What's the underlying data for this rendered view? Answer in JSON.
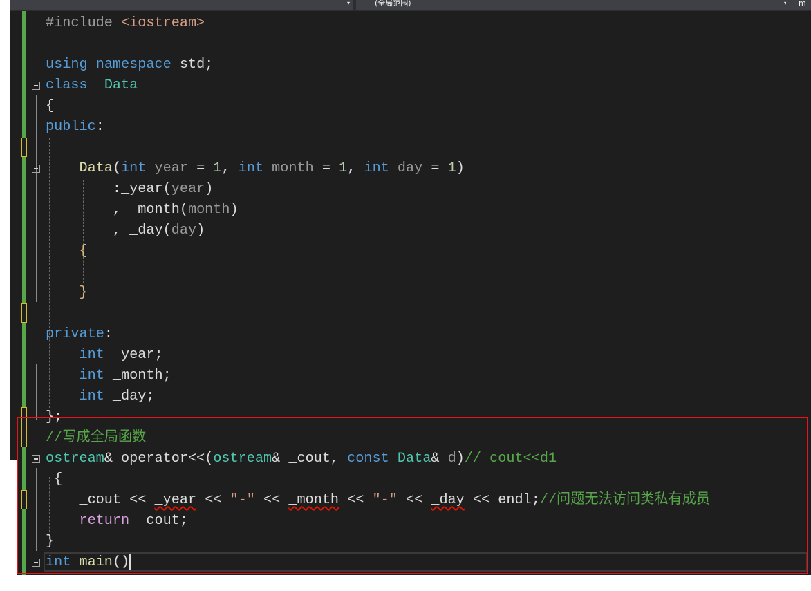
{
  "toolbar": {
    "scope_dropdown": "(全局范围)",
    "member_dropdown": "m"
  },
  "colors": {
    "keyword": "#569cd6",
    "type": "#4ec9b0",
    "function": "#dcdcaa",
    "comment": "#57a64a",
    "string": "#d69d85",
    "highlight_box": "#e8141a"
  },
  "code_lines": [
    [
      [
        "#include ",
        "pp"
      ],
      [
        "<iostream>",
        "st"
      ]
    ],
    [],
    [
      [
        "using",
        "kw"
      ],
      [
        " ",
        ""
      ],
      [
        "namespace",
        "kw"
      ],
      [
        " std;",
        ""
      ]
    ],
    [
      [
        "class",
        "kw"
      ],
      [
        "  ",
        ""
      ],
      [
        "Data",
        "ty"
      ]
    ],
    [
      [
        "{",
        ""
      ]
    ],
    [
      [
        "public",
        "kw"
      ],
      [
        ":",
        ""
      ]
    ],
    [],
    [
      [
        "    ",
        ""
      ],
      [
        "Data",
        "fn"
      ],
      [
        "(",
        ""
      ],
      [
        "int",
        "kw"
      ],
      [
        " ",
        ""
      ],
      [
        "year",
        "pa"
      ],
      [
        " = ",
        ""
      ],
      [
        "1",
        "nu"
      ],
      [
        ", ",
        ""
      ],
      [
        "int",
        "kw"
      ],
      [
        " ",
        ""
      ],
      [
        "month",
        "pa"
      ],
      [
        " = ",
        ""
      ],
      [
        "1",
        "nu"
      ],
      [
        ", ",
        ""
      ],
      [
        "int",
        "kw"
      ],
      [
        " ",
        ""
      ],
      [
        "day",
        "pa"
      ],
      [
        " = ",
        ""
      ],
      [
        "1",
        "nu"
      ],
      [
        ")",
        ""
      ]
    ],
    [
      [
        "        :_year(",
        ""
      ],
      [
        "year",
        "pa"
      ],
      [
        ")",
        ""
      ]
    ],
    [
      [
        "        , _month(",
        ""
      ],
      [
        "month",
        "pa"
      ],
      [
        ")",
        ""
      ]
    ],
    [
      [
        "        , _day(",
        ""
      ],
      [
        "day",
        "pa"
      ],
      [
        ")",
        ""
      ]
    ],
    [
      [
        "    ",
        ""
      ],
      [
        "{",
        "br"
      ]
    ],
    [],
    [
      [
        "    ",
        ""
      ],
      [
        "}",
        "br"
      ]
    ],
    [],
    [
      [
        "private",
        "kw"
      ],
      [
        ":",
        ""
      ]
    ],
    [
      [
        "    ",
        ""
      ],
      [
        "int",
        "kw"
      ],
      [
        " _year;",
        ""
      ]
    ],
    [
      [
        "    ",
        ""
      ],
      [
        "int",
        "kw"
      ],
      [
        " _month;",
        ""
      ]
    ],
    [
      [
        "    ",
        ""
      ],
      [
        "int",
        "kw"
      ],
      [
        " _day;",
        ""
      ]
    ],
    [
      [
        "};",
        ""
      ]
    ],
    [
      [
        "//写成全局函数",
        "cm"
      ]
    ],
    [
      [
        "ostream",
        "ty"
      ],
      [
        "& operator<<(",
        ""
      ],
      [
        "ostream",
        "ty"
      ],
      [
        "& _cout, ",
        ""
      ],
      [
        "const",
        "kw"
      ],
      [
        " ",
        ""
      ],
      [
        "Data",
        "ty"
      ],
      [
        "& ",
        ""
      ],
      [
        "d",
        "pa"
      ],
      [
        ")",
        ""
      ],
      [
        "// cout<<d1",
        "cm"
      ]
    ],
    [
      [
        " {",
        ""
      ]
    ],
    [
      [
        "    _cout << ",
        ""
      ],
      [
        "_year",
        "sq"
      ],
      [
        " << ",
        ""
      ],
      [
        "\"-\"",
        "st"
      ],
      [
        " << ",
        ""
      ],
      [
        "_month",
        "sq"
      ],
      [
        " << ",
        ""
      ],
      [
        "\"-\"",
        "st"
      ],
      [
        " << ",
        ""
      ],
      [
        "_day",
        "sq"
      ],
      [
        " << endl;",
        ""
      ],
      [
        "//问题无法访问类私有成员",
        "cm"
      ]
    ],
    [
      [
        "    ",
        ""
      ],
      [
        "return",
        "rt"
      ],
      [
        " _cout;",
        ""
      ]
    ],
    [
      [
        "}",
        ""
      ]
    ],
    [
      [
        "int",
        "kw"
      ],
      [
        " ",
        ""
      ],
      [
        "main",
        "fn"
      ],
      [
        "()",
        ""
      ]
    ]
  ]
}
